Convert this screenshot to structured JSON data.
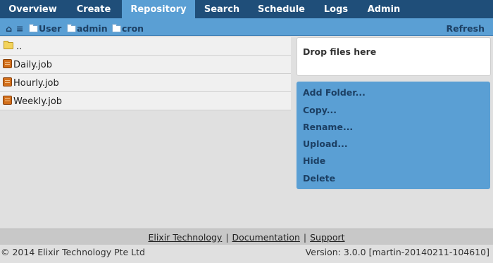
{
  "nav": {
    "tabs": [
      {
        "label": "Overview",
        "active": false
      },
      {
        "label": "Create",
        "active": false
      },
      {
        "label": "Repository",
        "active": true
      },
      {
        "label": "Search",
        "active": false
      },
      {
        "label": "Schedule",
        "active": false
      },
      {
        "label": "Logs",
        "active": false
      },
      {
        "label": "Admin",
        "active": false
      }
    ]
  },
  "breadcrumb": {
    "home_icon": "⌂",
    "list_icon": "≡",
    "items": [
      "User",
      "admin",
      "cron"
    ],
    "refresh_label": "Refresh"
  },
  "files": [
    {
      "name": "..",
      "type": "folder"
    },
    {
      "name": "Daily.job",
      "type": "job"
    },
    {
      "name": "Hourly.job",
      "type": "job"
    },
    {
      "name": "Weekly.job",
      "type": "job"
    }
  ],
  "dropzone": {
    "label": "Drop files here"
  },
  "actions": [
    "Add Folder...",
    "Copy...",
    "Rename...",
    "Upload...",
    "Hide",
    "Delete"
  ],
  "footer": {
    "links": [
      "Elixir Technology",
      "Documentation",
      "Support"
    ],
    "separator": "|",
    "copyright": "© 2014 Elixir Technology Pte Ltd",
    "version": "Version: 3.0.0 [martin-20140211-104610]"
  },
  "colors": {
    "nav_bg": "#1f4e79",
    "accent": "#5a9fd4",
    "link_dark": "#1c3f63"
  }
}
